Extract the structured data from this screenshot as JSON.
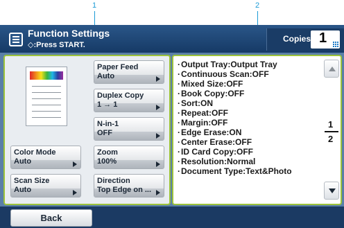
{
  "callouts": [
    "1",
    "2"
  ],
  "header": {
    "title": "Function Settings",
    "subtitle": "◇:Press START.",
    "copies_label": "Copies:",
    "copies_value": "1"
  },
  "settings": {
    "color_mode": {
      "label": "Color Mode",
      "value": "Auto"
    },
    "scan_size": {
      "label": "Scan Size",
      "value": "Auto"
    },
    "paper_feed": {
      "label": "Paper Feed",
      "value": "Auto"
    },
    "duplex_copy": {
      "label": "Duplex Copy",
      "value": "1 → 1"
    },
    "n_in_1": {
      "label": "N-in-1",
      "value": "OFF"
    },
    "zoom": {
      "label": "Zoom",
      "value": "100%"
    },
    "direction": {
      "label": "Direction",
      "value": "Top Edge on ..."
    }
  },
  "summary": [
    "Output Tray:Output Tray",
    "Continuous Scan:OFF",
    "Mixed Size:OFF",
    "Book Copy:OFF",
    "Sort:ON",
    "Repeat:OFF",
    "Margin:OFF",
    "Edge Erase:ON",
    "Center Erase:OFF",
    "ID Card Copy:OFF",
    "Resolution:Normal",
    "Document Type:Text&Photo"
  ],
  "pager": {
    "current": "1",
    "total": "2"
  },
  "footer": {
    "back_label": "Back"
  },
  "colors": {
    "accent": "#9cc23a",
    "header": "#1b3a63",
    "callout": "#1a9ad6"
  },
  "icons": [
    "function-settings-icon",
    "start-diamond-icon",
    "keypad-icon",
    "scroll-up-icon",
    "scroll-down-icon"
  ]
}
